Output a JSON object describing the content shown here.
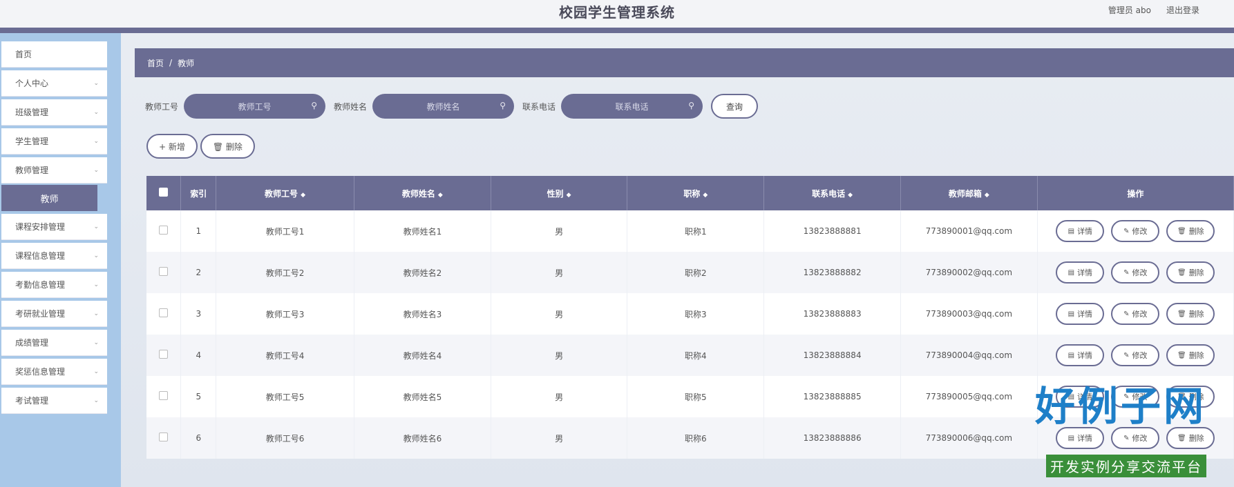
{
  "header": {
    "title": "校园学生管理系统",
    "user": "管理员 abo",
    "logout": "退出登录"
  },
  "sidebar": {
    "items": [
      {
        "label": "首页",
        "has_chevron": false
      },
      {
        "label": "个人中心",
        "has_chevron": true
      },
      {
        "label": "班级管理",
        "has_chevron": true
      },
      {
        "label": "学生管理",
        "has_chevron": true
      },
      {
        "label": "教师管理",
        "has_chevron": true
      },
      {
        "label": "课程安排管理",
        "has_chevron": true
      },
      {
        "label": "课程信息管理",
        "has_chevron": true
      },
      {
        "label": "考勤信息管理",
        "has_chevron": true
      },
      {
        "label": "考研就业管理",
        "has_chevron": true
      },
      {
        "label": "成绩管理",
        "has_chevron": true
      },
      {
        "label": "奖惩信息管理",
        "has_chevron": true
      },
      {
        "label": "考试管理",
        "has_chevron": true
      }
    ],
    "active_sub": "教师"
  },
  "breadcrumb": {
    "home": "首页",
    "sep": "/",
    "current": "教师"
  },
  "search": {
    "fields": [
      {
        "label": "教师工号",
        "placeholder": "教师工号"
      },
      {
        "label": "教师姓名",
        "placeholder": "教师姓名"
      },
      {
        "label": "联系电话",
        "placeholder": "联系电话"
      }
    ],
    "query_label": "查询",
    "search_icon": "⚲"
  },
  "actions": {
    "add_label": "+ 新增",
    "delete_label": "🗑 删除"
  },
  "table": {
    "headers": [
      "索引",
      "教师工号",
      "教师姓名",
      "性别",
      "职称",
      "联系电话",
      "教师邮箱",
      "操作"
    ],
    "sort_icon": "◆",
    "rows": [
      {
        "idx": "1",
        "no": "教师工号1",
        "name": "教师姓名1",
        "sex": "男",
        "title": "职称1",
        "phone": "13823888881",
        "email": "773890001@qq.com"
      },
      {
        "idx": "2",
        "no": "教师工号2",
        "name": "教师姓名2",
        "sex": "男",
        "title": "职称2",
        "phone": "13823888882",
        "email": "773890002@qq.com"
      },
      {
        "idx": "3",
        "no": "教师工号3",
        "name": "教师姓名3",
        "sex": "男",
        "title": "职称3",
        "phone": "13823888883",
        "email": "773890003@qq.com"
      },
      {
        "idx": "4",
        "no": "教师工号4",
        "name": "教师姓名4",
        "sex": "男",
        "title": "职称4",
        "phone": "13823888884",
        "email": "773890004@qq.com"
      },
      {
        "idx": "5",
        "no": "教师工号5",
        "name": "教师姓名5",
        "sex": "男",
        "title": "职称5",
        "phone": "13823888885",
        "email": "773890005@qq.com"
      },
      {
        "idx": "6",
        "no": "教师工号6",
        "name": "教师姓名6",
        "sex": "男",
        "title": "职称6",
        "phone": "13823888886",
        "email": "773890006@qq.com"
      }
    ],
    "op_labels": {
      "detail": "详情",
      "edit": "修改",
      "delete": "删除"
    }
  },
  "watermark": {
    "big": "好例子网",
    "small": "开发实例分享交流平台"
  }
}
